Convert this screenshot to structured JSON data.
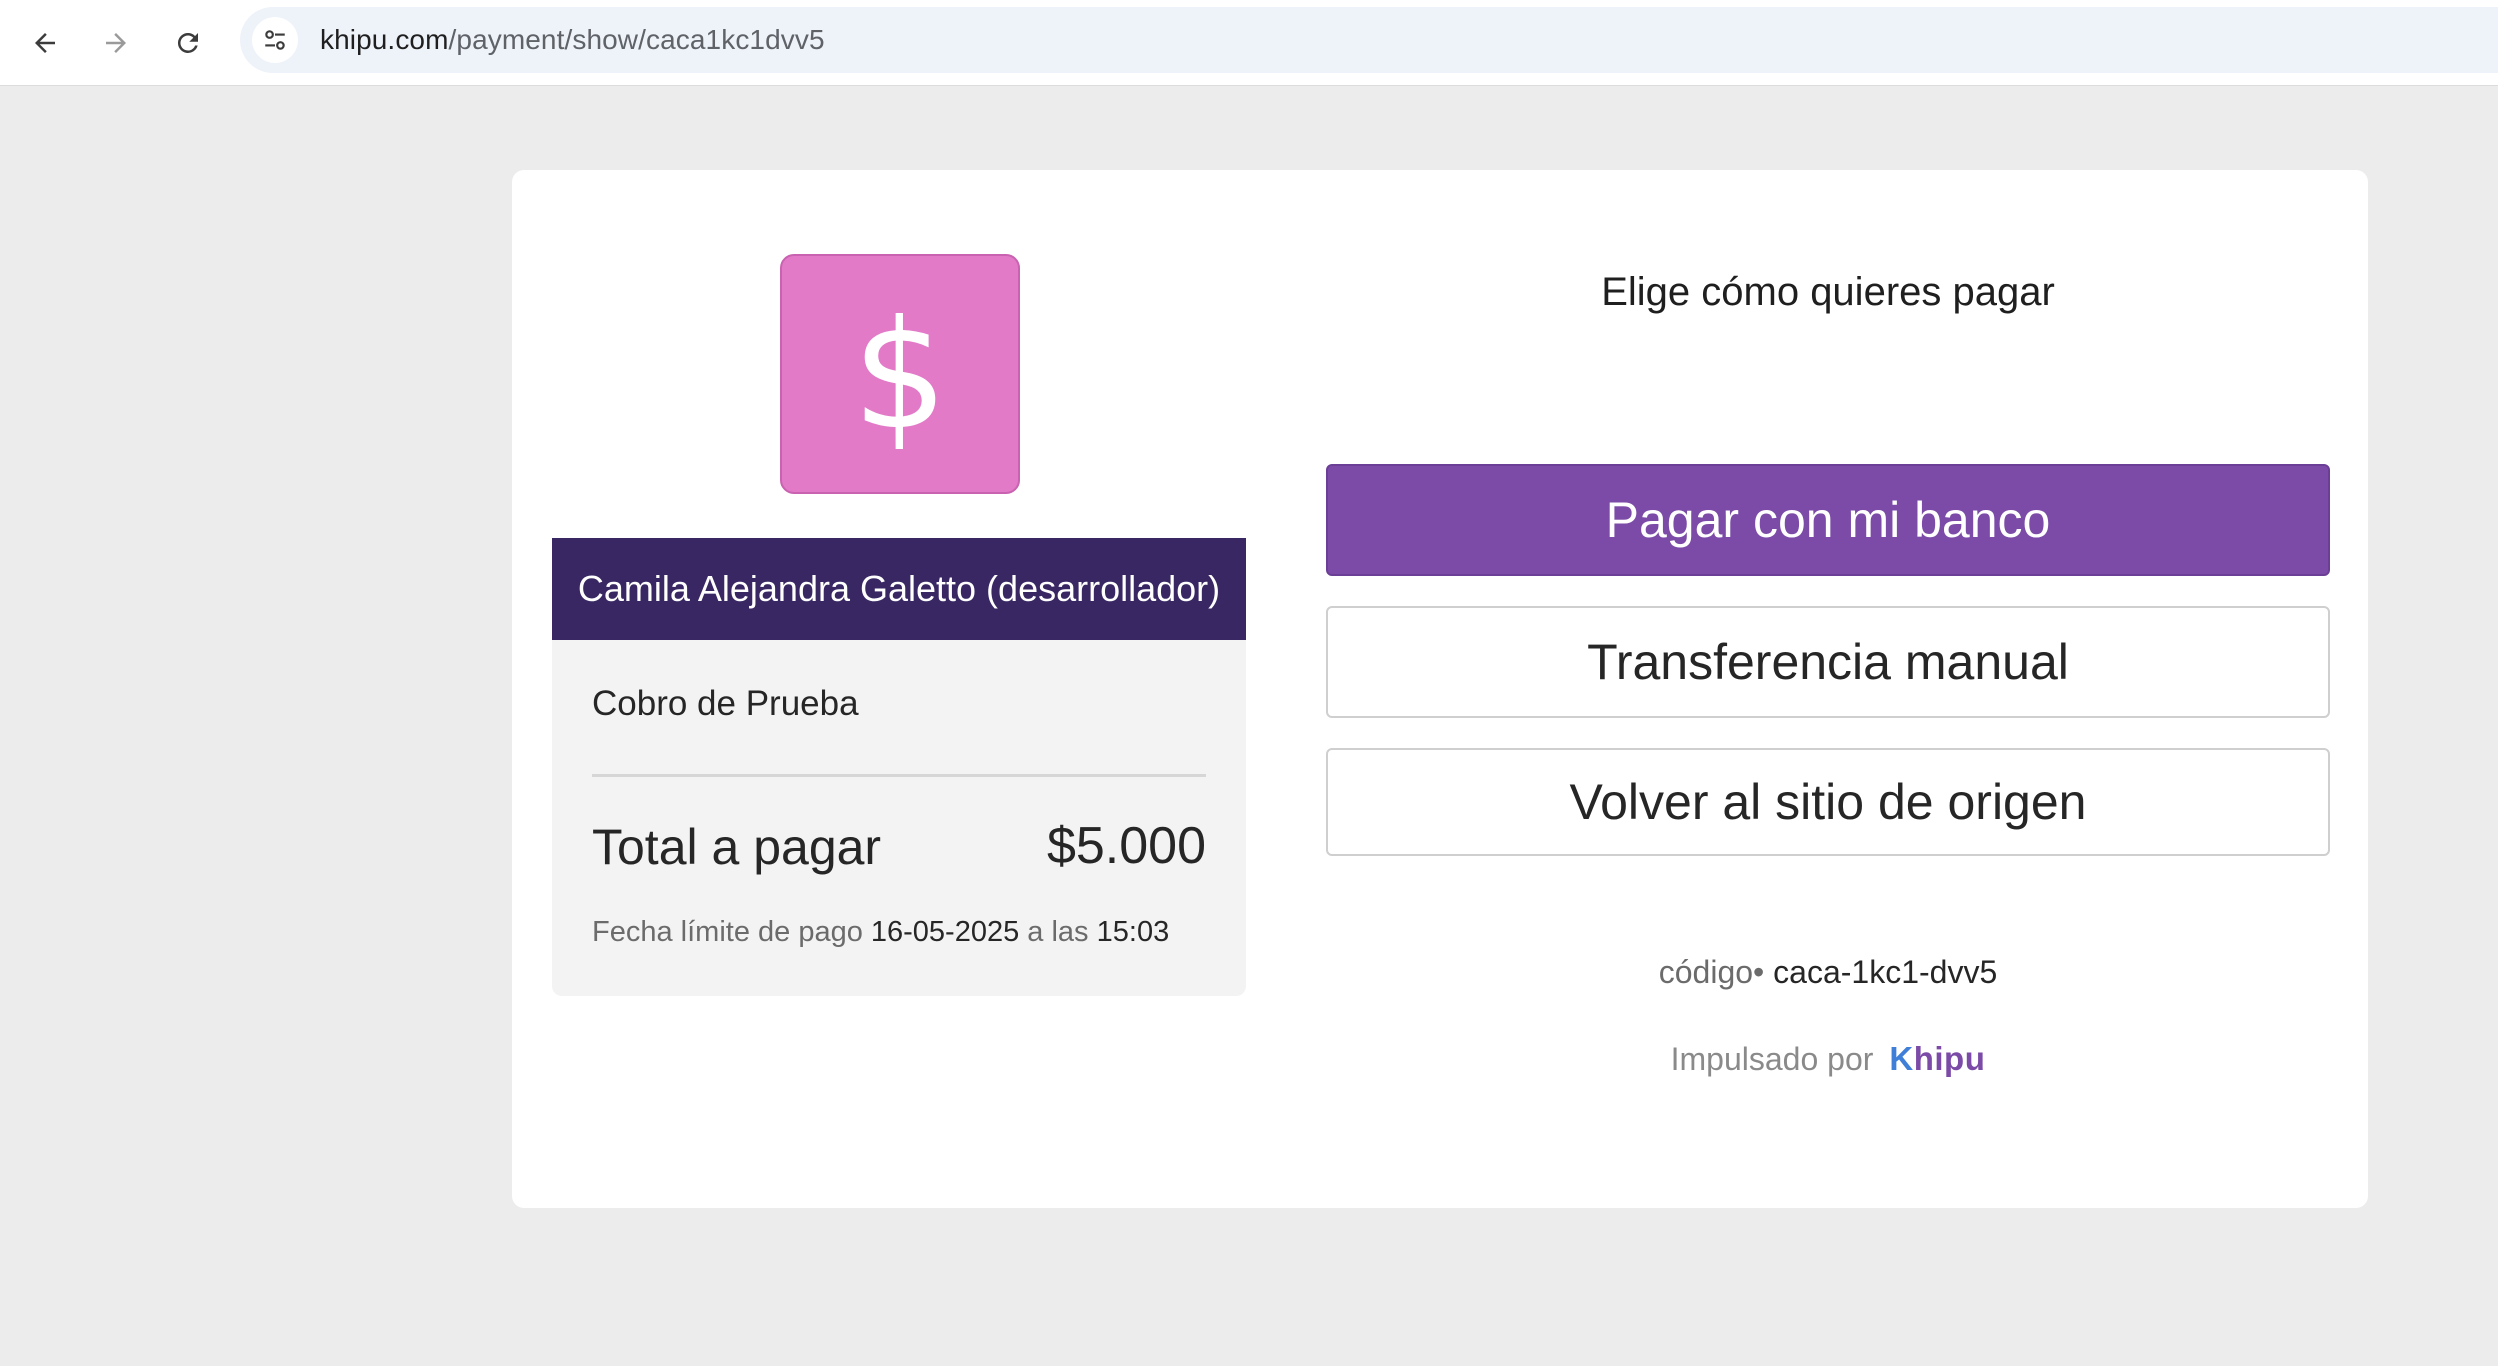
{
  "browser": {
    "url_host": "khipu.com",
    "url_path": "/payment/show/caca1kc1dvv5",
    "back_icon": "arrow-left-icon",
    "forward_icon": "arrow-right-icon",
    "reload_icon": "reload-icon",
    "site_info_icon": "tune-icon"
  },
  "merchant": {
    "logo_symbol": "$",
    "logo_color": "#e27ac8",
    "name": "Camila Alejandra Galetto (desarrollador)",
    "banner_color": "#382763"
  },
  "summary": {
    "subject": "Cobro de Prueba",
    "total_label": "Total a pagar",
    "total_amount": "$5.000",
    "deadline_label": "Fecha límite de pago",
    "deadline_date": "16-05-2025",
    "deadline_connector": "a las",
    "deadline_time": "15:03"
  },
  "payment": {
    "title": "Elige cómo quieres pagar",
    "primary_button": "Pagar con mi banco",
    "manual_button": "Transferencia manual",
    "back_button": "Volver al sitio de origen",
    "primary_color": "#7b4ba7"
  },
  "footer": {
    "code_label": "código",
    "code_value": "caca-1kc1-dvv5",
    "powered_by": "Impulsado por",
    "brand_first": "K",
    "brand_rest": "hipu"
  }
}
